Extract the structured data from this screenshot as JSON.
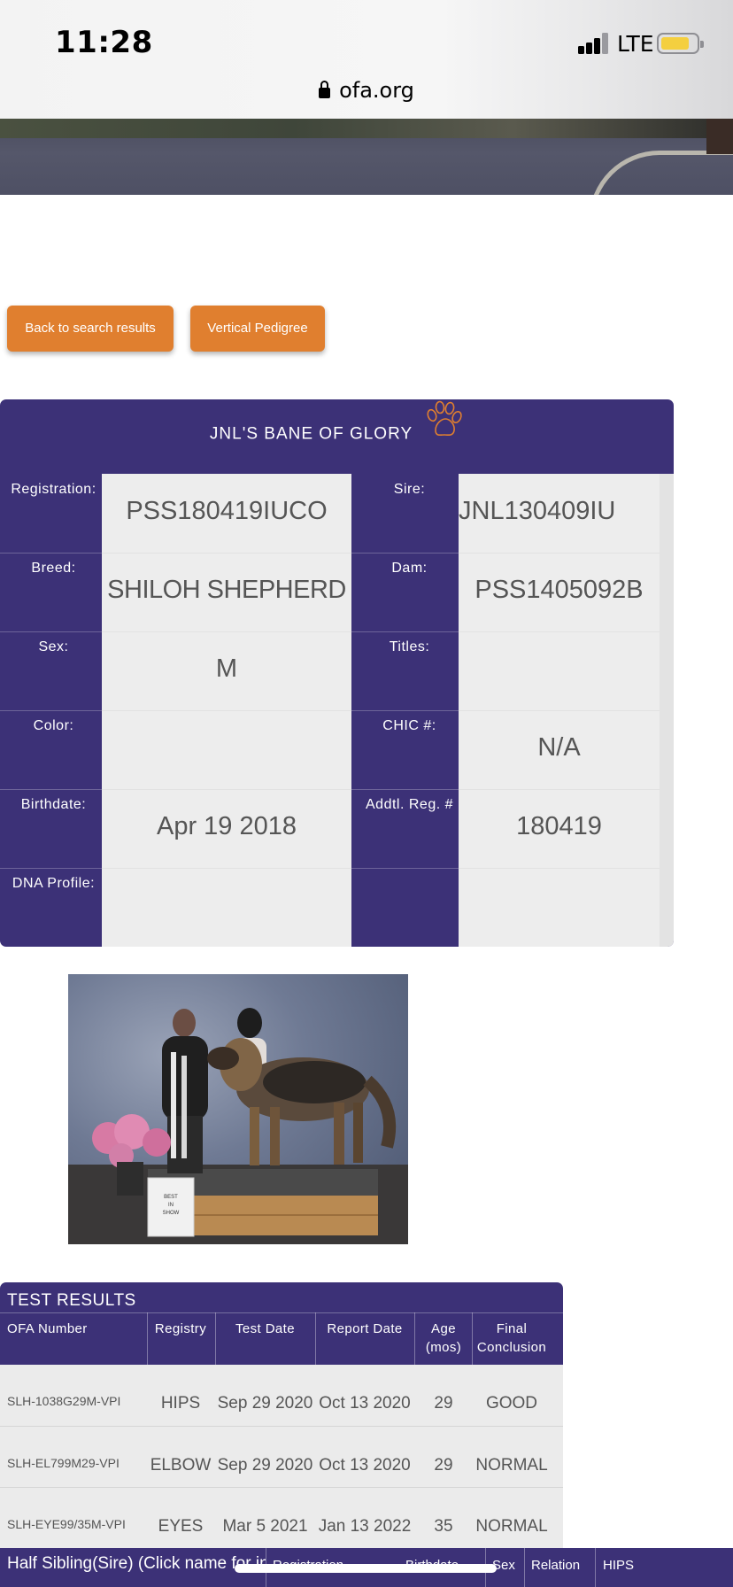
{
  "status_bar": {
    "time": "11:28",
    "network": "LTE"
  },
  "browser": {
    "url": "ofa.org"
  },
  "actions": {
    "back": "Back to search results",
    "pedigree": "Vertical Pedigree"
  },
  "dog": {
    "name": "JNL'S BANE OF GLORY",
    "labels": {
      "registration": "Registration:",
      "breed": "Breed:",
      "sex": "Sex:",
      "color": "Color:",
      "birthdate": "Birthdate:",
      "dna": "DNA Profile:",
      "sire": "Sire:",
      "dam": "Dam:",
      "titles": "Titles:",
      "chic": "CHIC #:",
      "addtl": "Addtl. Reg. #"
    },
    "values": {
      "registration": "PSS180419IUCO",
      "breed": "SHILOH SHEPHERD",
      "sex": "M",
      "color": "",
      "birthdate": "Apr 19 2018",
      "dna": "",
      "sire": "JNL130409IU",
      "dam": "PSS1405092B",
      "titles": "",
      "chic": "N/A",
      "addtl": "180419"
    }
  },
  "photo": {
    "sign_text": "BEST IN SHOW"
  },
  "test_results": {
    "title": "TEST RESULTS",
    "headers": [
      "OFA Number",
      "Registry",
      "Test Date",
      "Report Date",
      "Age (mos)",
      "Final Conclusion"
    ],
    "rows": [
      [
        "SLH-1038G29M-VPI",
        "HIPS",
        "Sep 29 2020",
        "Oct 13 2020",
        "29",
        "GOOD"
      ],
      [
        "SLH-EL799M29-VPI",
        "ELBOW",
        "Sep 29 2020",
        "Oct 13 2020",
        "29",
        "NORMAL"
      ],
      [
        "SLH-EYE99/35M-VPI",
        "EYES",
        "Mar 5 2021",
        "Jan 13 2022",
        "35",
        "NORMAL"
      ]
    ]
  },
  "siblings": {
    "title": "Half Sibling(Sire) (Click name for info)",
    "headers": [
      "Registration",
      "Birthdate",
      "Sex",
      "Relation",
      "HIPS"
    ]
  },
  "colors": {
    "purple": "#3c3177",
    "orange": "#e07f2f",
    "cell_bg": "#ededed"
  }
}
